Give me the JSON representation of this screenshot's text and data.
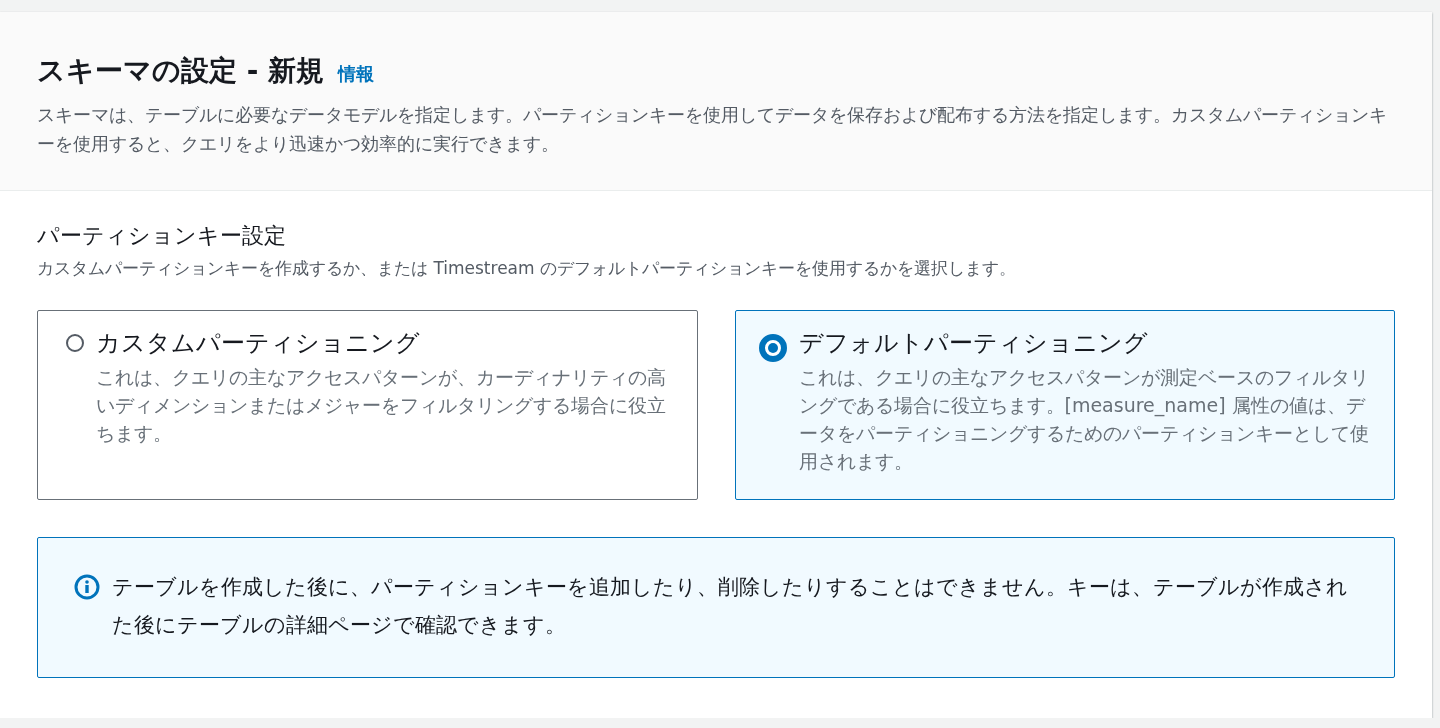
{
  "header": {
    "title": "スキーマの設定 - 新規",
    "info_link": "情報",
    "description": "スキーマは、テーブルに必要なデータモデルを指定します。パーティションキーを使用してデータを保存および配布する方法を指定します。カスタムパーティションキーを使用すると、クエリをより迅速かつ効率的に実行できます。"
  },
  "partition_settings": {
    "label": "パーティションキー設定",
    "description": "カスタムパーティションキーを作成するか、または Timestream のデフォルトパーティションキーを使用するかを選択します。",
    "options": [
      {
        "label": "カスタムパーティショニング",
        "description": "これは、クエリの主なアクセスパターンが、カーディナリティの高いディメンションまたはメジャーをフィルタリングする場合に役立ちます。",
        "selected": false
      },
      {
        "label": "デフォルトパーティショニング",
        "description": "これは、クエリの主なアクセスパターンが測定ベースのフィルタリングである場合に役立ちます。[measure_name] 属性の値は、データをパーティショニングするためのパーティションキーとして使用されます。",
        "selected": true
      }
    ]
  },
  "alert": {
    "text": "テーブルを作成した後に、パーティションキーを追加したり、削除したりすることはできません。キーは、テーブルが作成された後にテーブルの詳細ページで確認できます。"
  }
}
